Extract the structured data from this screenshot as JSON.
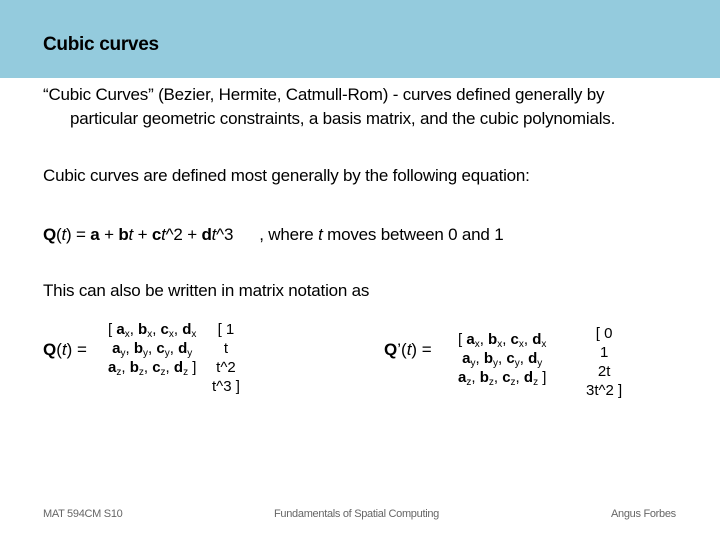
{
  "header": {
    "title": "Cubic curves",
    "color": "#94cbdd"
  },
  "body": {
    "intro_line1": "“Cubic Curves” (Bezier, Hermite, Catmull-Rom) - curves defined generally by",
    "intro_line2": "particular geometric constraints, a basis matrix, and the cubic polynomials.",
    "defined_text": "Cubic curves are defined most generally by the following equation:",
    "equation": {
      "Q": "Q",
      "t_open": "(",
      "t": "t",
      "t_close": ")",
      "eq": " = ",
      "a": "a",
      "plus1": " + ",
      "b": "b",
      "bt": "t",
      "plus2": " + ",
      "c": "c",
      "ct": "t",
      "pow2": "^2",
      "plus3": " + ",
      "d": "d",
      "dt": "t",
      "pow3": "^3",
      "where_pre": ", where ",
      "where_t": "t",
      "where_post": " moves between 0 and 1"
    },
    "matrix_intro": "This can also be written in matrix notation as"
  },
  "matrix1": {
    "lhs": {
      "Q": "Q",
      "rest_pre": "(",
      "t": "t",
      "rest_post": ") ="
    },
    "coeff_rows": [
      {
        "open": "[ ",
        "a": "a",
        "as": "x",
        "b": "b",
        "bs": "x",
        "c": "c",
        "cs": "x",
        "d": "d",
        "ds": "x",
        "close": ""
      },
      {
        "open": "",
        "a": "a",
        "as": "y",
        "b": "b",
        "bs": "y",
        "c": "c",
        "cs": "y",
        "d": "d",
        "ds": "y",
        "close": ""
      },
      {
        "open": "",
        "a": "a",
        "as": "z",
        "b": "b",
        "bs": "z",
        "c": "c",
        "cs": "z",
        "d": "d",
        "ds": "z",
        "close": " ]"
      }
    ],
    "vector": [
      "[ 1",
      "t",
      "t^2",
      "t^3 ]"
    ]
  },
  "matrix2": {
    "lhs": {
      "Q": "Q",
      "rest_pre": "’(",
      "t": "t",
      "rest_post": ") ="
    },
    "coeff_rows": [
      {
        "open": "[ ",
        "a": "a",
        "as": "x",
        "b": "b",
        "bs": "x",
        "c": "c",
        "cs": "x",
        "d": "d",
        "ds": "x",
        "close": ""
      },
      {
        "open": "",
        "a": "a",
        "as": "y",
        "b": "b",
        "bs": "y",
        "c": "c",
        "cs": "y",
        "d": "d",
        "ds": "y",
        "close": ""
      },
      {
        "open": "",
        "a": "a",
        "as": "z",
        "b": "b",
        "bs": "z",
        "c": "c",
        "cs": "z",
        "d": "d",
        "ds": "z",
        "close": " ]"
      }
    ],
    "vector": [
      "[ 0",
      "1",
      "2t",
      "3t^2 ]"
    ]
  },
  "footer": {
    "left": "MAT 594CM S10",
    "center": "Fundamentals of Spatial Computing",
    "right": "Angus Forbes"
  }
}
